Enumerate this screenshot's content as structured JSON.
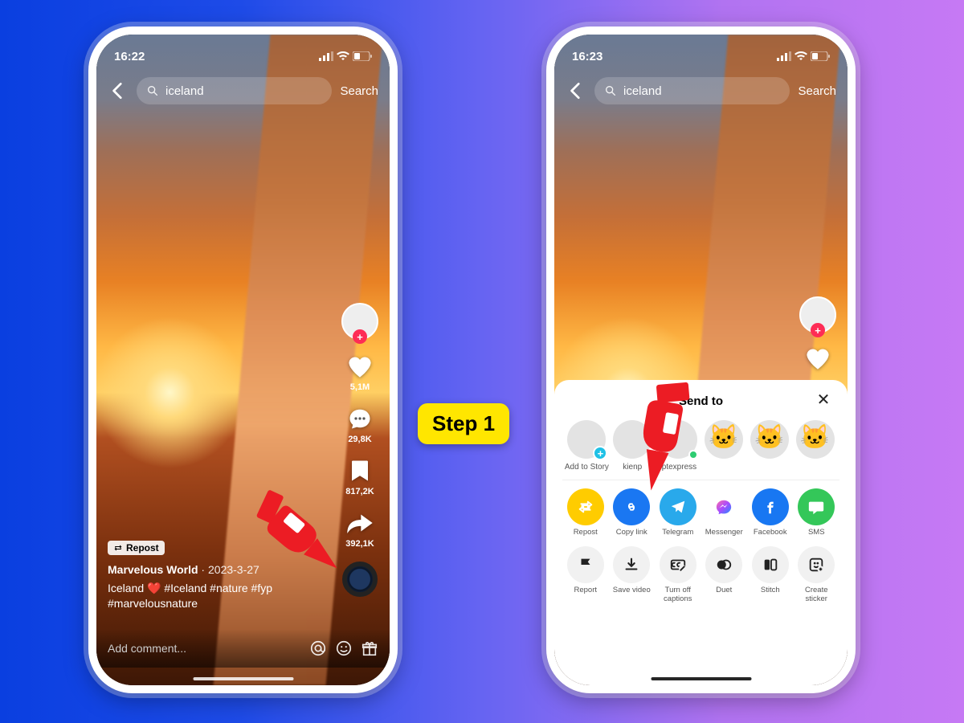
{
  "step_label": "Step 1",
  "phone_left": {
    "status_time": "16:22",
    "search_text": "iceland",
    "search_button": "Search",
    "rail": {
      "likes": "5,1M",
      "comments": "29,8K",
      "saves": "817,2K",
      "shares": "392,1K"
    },
    "repost_chip": "Repost",
    "author": "Marvelous World",
    "date_sep": " · ",
    "date": "2023-3-27",
    "caption": "Iceland ❤️ #Iceland #nature #fyp #marvelousnature",
    "comment_placeholder": "Add comment..."
  },
  "phone_right": {
    "status_time": "16:23",
    "search_text": "iceland",
    "search_button": "Search",
    "sheet": {
      "title": "Send to",
      "contacts": [
        {
          "label": "Add to Story",
          "type": "add"
        },
        {
          "label": "kienp",
          "type": "avatar"
        },
        {
          "label": "fptexpress",
          "type": "avatar_online"
        },
        {
          "label": "",
          "type": "cat"
        },
        {
          "label": "",
          "type": "cat"
        },
        {
          "label": "",
          "type": "cat"
        }
      ],
      "options_row1": [
        {
          "label": "Repost",
          "icon": "repost",
          "color": "yellow"
        },
        {
          "label": "Copy link",
          "icon": "link",
          "color": "blue"
        },
        {
          "label": "Telegram",
          "icon": "telegram",
          "color": "tele"
        },
        {
          "label": "Messenger",
          "icon": "messenger",
          "color": "mess"
        },
        {
          "label": "Facebook",
          "icon": "facebook",
          "color": "fb"
        },
        {
          "label": "SMS",
          "icon": "sms",
          "color": "sms"
        }
      ],
      "options_row2": [
        {
          "label": "Report",
          "icon": "flag"
        },
        {
          "label": "Save video",
          "icon": "download"
        },
        {
          "label": "Turn off captions",
          "icon": "cc-off"
        },
        {
          "label": "Duet",
          "icon": "duet"
        },
        {
          "label": "Stitch",
          "icon": "stitch"
        },
        {
          "label": "Create sticker",
          "icon": "sticker"
        }
      ]
    }
  }
}
